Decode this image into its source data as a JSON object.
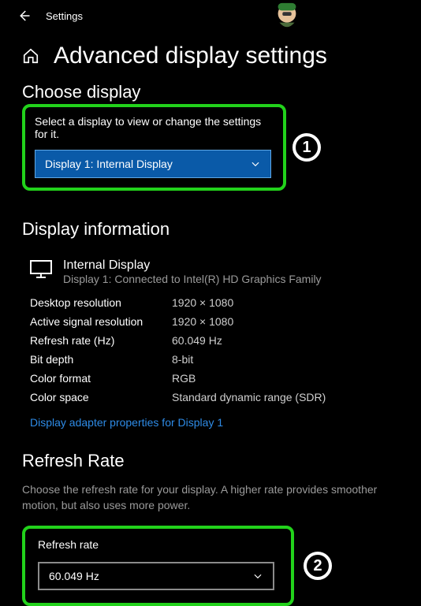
{
  "titlebar": {
    "title": "Settings"
  },
  "page": {
    "title": "Advanced display settings",
    "chooseDisplayHeading": "Choose display",
    "chooseDisplayHelp": "Select a display to view or change the settings for it.",
    "displayDropdownValue": "Display 1: Internal Display",
    "displayInfoHeading": "Display information",
    "displayName": "Internal Display",
    "displayConnection": "Display 1: Connected to Intel(R) HD Graphics Family",
    "specs": {
      "desktopResLabel": "Desktop resolution",
      "desktopResValue": "1920 × 1080",
      "activeResLabel": "Active signal resolution",
      "activeResValue": "1920 × 1080",
      "refreshLabel": "Refresh rate (Hz)",
      "refreshValue": "60.049 Hz",
      "bitDepthLabel": "Bit depth",
      "bitDepthValue": "8-bit",
      "colorFormatLabel": "Color format",
      "colorFormatValue": "RGB",
      "colorSpaceLabel": "Color space",
      "colorSpaceValue": "Standard dynamic range (SDR)"
    },
    "adapterLinkText": "Display adapter properties for Display 1",
    "refreshRateHeading": "Refresh Rate",
    "refreshRateHelp": "Choose the refresh rate for your display. A higher rate provides smoother motion, but also uses more power.",
    "refreshRateFieldLabel": "Refresh rate",
    "refreshRateDropdownValue": "60.049 Hz"
  },
  "annotations": {
    "badge1": "1",
    "badge2": "2"
  }
}
